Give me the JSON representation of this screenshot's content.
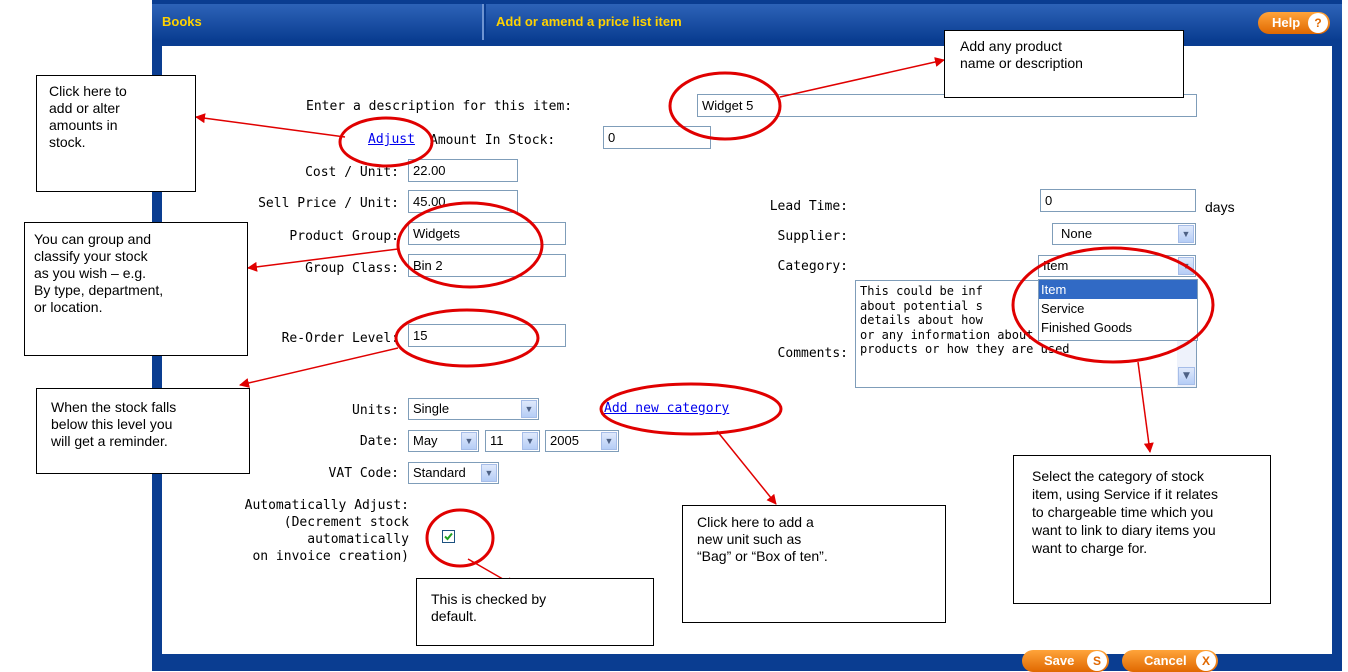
{
  "app": {
    "section_title": "Books",
    "page_title": "Add or amend a price list item",
    "help_label": "Help",
    "help_icon": "?",
    "save_label": "Save",
    "save_icon": "S",
    "cancel_label": "Cancel",
    "cancel_icon": "X"
  },
  "form": {
    "description_label": "Enter a description for this item:",
    "description_value": "Widget 5",
    "adjust_link": "Adjust",
    "amount_in_stock_label": "Amount In Stock:",
    "amount_in_stock_value": "0",
    "cost_label": "Cost / Unit:",
    "cost_value": "22.00",
    "sell_label": "Sell Price / Unit:",
    "sell_value": "45.00",
    "product_group_label": "Product Group:",
    "product_group_value": "Widgets",
    "group_class_label": "Group Class:",
    "group_class_value": "Bin 2",
    "reorder_label": "Re-Order Level:",
    "reorder_value": "15",
    "units_label": "Units:",
    "units_value": "Single",
    "add_category_link": "Add new category",
    "date_label": "Date:",
    "date_month": "May",
    "date_day": "11",
    "date_year": "2005",
    "vat_label": "VAT Code:",
    "vat_value": "Standard",
    "auto_adjust_lines": [
      "Automatically Adjust:",
      "(Decrement stock",
      "automatically",
      "on invoice creation)"
    ],
    "auto_adjust_checked": true,
    "lead_time_label": "Lead Time:",
    "lead_time_value": "0",
    "lead_time_unit": "days",
    "supplier_label": "Supplier:",
    "supplier_value": "None",
    "category_label": "Category:",
    "category_value": "Item",
    "category_options": [
      "Item",
      "Service",
      "Finished Goods"
    ],
    "comments_label": "Comments:",
    "comments_lines": [
      "This could be inf",
      "about potential s",
      "details about how",
      "or any information about the",
      "products or how they are used"
    ]
  },
  "callouts": {
    "product_name": [
      "Add any product",
      "name or description"
    ],
    "adjust": [
      "Click here to",
      "add or alter",
      "amounts in",
      "stock."
    ],
    "group": [
      "You can group and",
      "classify your stock",
      "as you wish – e.g.",
      "By type, department,",
      "or location."
    ],
    "reorder": [
      "When the stock falls",
      "below this level you",
      "will get a reminder."
    ],
    "checked": [
      "This is checked by",
      "default."
    ],
    "add_unit": [
      "Click here to add a",
      "new unit such as",
      "“Bag” or “Box of ten”."
    ],
    "category": [
      "Select the category of stock",
      "item, using Service if it relates",
      "to chargeable time which you",
      "want to link to diary items you",
      "want to charge for."
    ]
  },
  "colors": {
    "frame_blue": "#0a3d91",
    "header_text": "#ffd200",
    "button_orange": "#f07d10",
    "annotation_red": "#e00000"
  }
}
